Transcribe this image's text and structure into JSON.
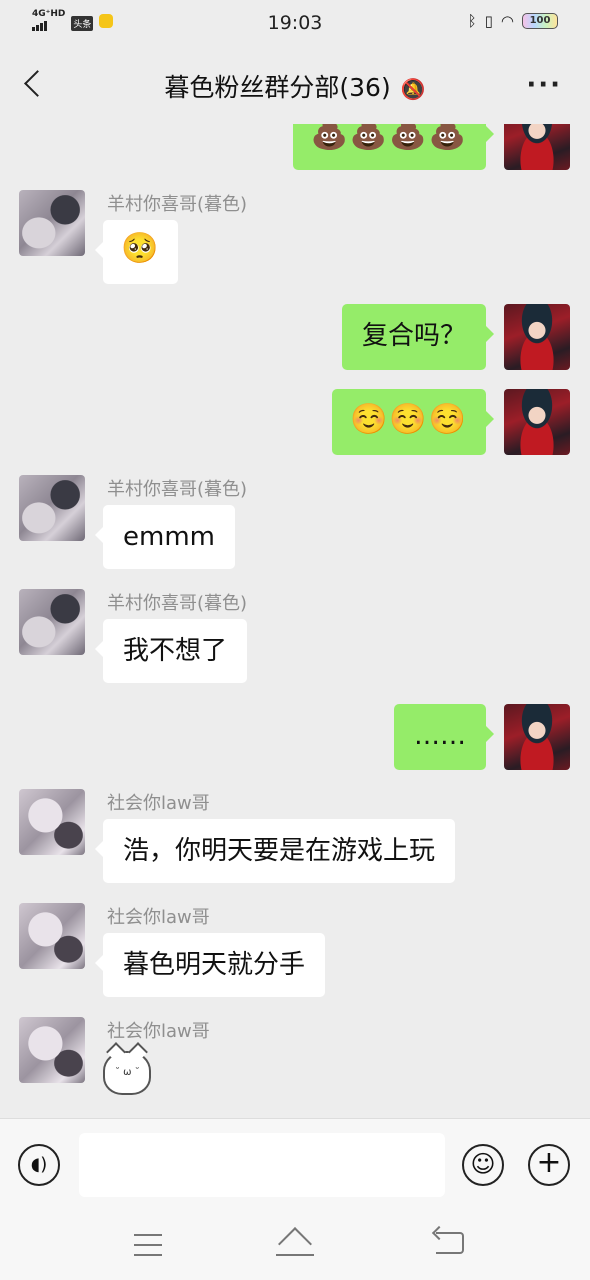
{
  "status_bar": {
    "network": "4G⁺HD",
    "app_tag": "头条",
    "time": "19:03",
    "bluetooth_icon": "bluetooth-icon",
    "vibrate_icon": "vibrate-icon",
    "wifi_icon": "wifi-icon",
    "battery": "100"
  },
  "header": {
    "back_icon": "chevron-left-icon",
    "title": "暮色粉丝群分部(36)",
    "mute_icon": "bell-muted-icon",
    "more_icon": "more-dots-icon"
  },
  "messages": [
    {
      "side": "right",
      "content": "💩💩💩💩"
    },
    {
      "side": "left",
      "sender": "羊村你喜哥(暮色)",
      "content": "🥺"
    },
    {
      "side": "right",
      "content": "复合吗？"
    },
    {
      "side": "right",
      "content": "☺️☺️☺️"
    },
    {
      "side": "left",
      "sender": "羊村你喜哥(暮色)",
      "content": "emmm"
    },
    {
      "side": "left",
      "sender": "羊村你喜哥(暮色)",
      "content": "我不想了"
    },
    {
      "side": "right",
      "content": "……"
    },
    {
      "side": "left",
      "sender": "社会你law哥",
      "content": "浩，你明天要是在游戏上玩"
    },
    {
      "side": "left",
      "sender": "社会你law哥",
      "content": "暮色明天就分手"
    },
    {
      "side": "left",
      "sender": "社会你law哥",
      "content": "cat-sticker"
    }
  ],
  "input_bar": {
    "voice_icon": "voice-icon",
    "text_value": "",
    "emoji_icon": "emoji-icon",
    "plus_icon": "plus-icon"
  },
  "system_nav": [
    "menu-icon",
    "home-icon",
    "back-icon"
  ]
}
